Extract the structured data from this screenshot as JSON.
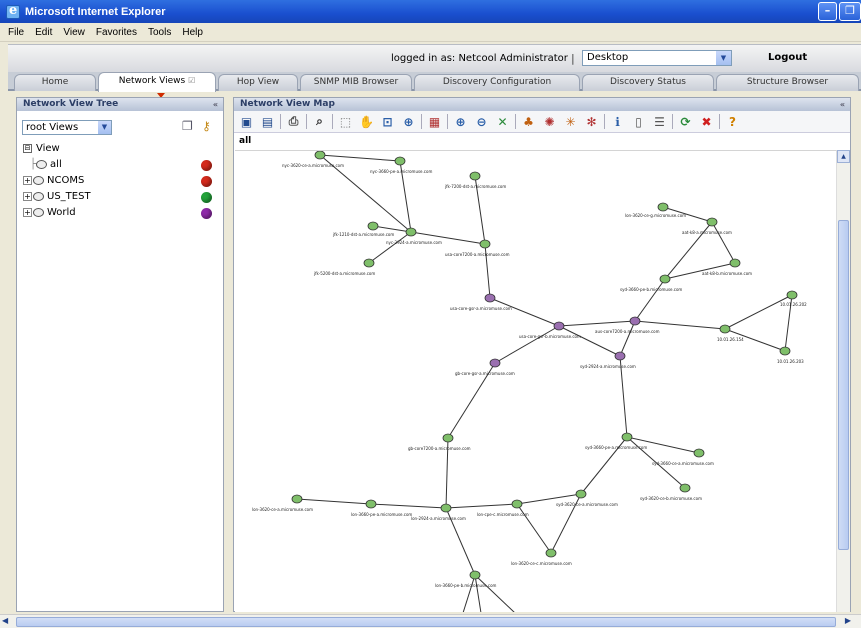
{
  "window": {
    "title": "Microsoft Internet Explorer"
  },
  "menu": [
    "File",
    "Edit",
    "View",
    "Favorites",
    "Tools",
    "Help"
  ],
  "header": {
    "logged_in": "logged in as: Netcool Administrator",
    "separator": "|",
    "desktop_value": "Desktop",
    "logout": "Logout"
  },
  "tabs": [
    {
      "label": "Home"
    },
    {
      "label": "Network Views",
      "active": true
    },
    {
      "label": "Hop View"
    },
    {
      "label": "SNMP MIB Browser"
    },
    {
      "label": "Discovery Configuration"
    },
    {
      "label": "Discovery Status"
    },
    {
      "label": "Structure Browser"
    }
  ],
  "left_panel": {
    "title": "Network View Tree",
    "root_select": "root Views",
    "tree": [
      {
        "label": "View",
        "status": ""
      },
      {
        "label": "all",
        "status": "#d42a1c"
      },
      {
        "label": "NCOMS",
        "status": "#d42a1c"
      },
      {
        "label": "US_TEST",
        "status": "#23a23a"
      },
      {
        "label": "World",
        "status": "#8e2aa8"
      }
    ]
  },
  "right_panel": {
    "title": "Network View Map",
    "view_label": "all"
  },
  "map": {
    "nodes": [
      {
        "label": "nyc-3620-ce-a.micromuse.com"
      },
      {
        "label": "nyc-3660-pe-a.micromuse.com"
      },
      {
        "label": "jfk-7200-dst-a.micromuse.com"
      },
      {
        "label": "jfk-1210-dst-a.micromuse.com"
      },
      {
        "label": "nyc-2924-a.micromuse.com"
      },
      {
        "label": "jfk-5200-dst-a.micromuse.com"
      },
      {
        "label": "usa-core7200-a.micromuse.com"
      },
      {
        "label": "usa-core-gsr-a.micromuse.com"
      },
      {
        "label": "usa-core-gsr-b.micromuse.com"
      },
      {
        "label": "aus-core7200-a.micromuse.com"
      },
      {
        "label": "syd-2924-a.micromuse.com"
      },
      {
        "label": "gb-core-gsr-a.micromuse.com"
      },
      {
        "label": "gb-core7200-a.micromuse.com"
      },
      {
        "label": "lon-3620-ce-g.micromuse.com"
      },
      {
        "label": "aat-k8-a.micromuse.com"
      },
      {
        "label": "aat-k8-b.micromuse.com"
      },
      {
        "label": "syd-3660-pe-b.micromuse.com"
      },
      {
        "label": "10.01.26.202"
      },
      {
        "label": "10.01.26.154"
      },
      {
        "label": "10.01.26.203"
      },
      {
        "label": "syd-3660-pe-a.micromuse.com"
      },
      {
        "label": "syd-3660-ce-a.micromuse.com"
      },
      {
        "label": "syd-3620-ce-b.micromuse.com"
      },
      {
        "label": "lon-3620-ce-a.micromuse.com"
      },
      {
        "label": "lon-3660-pe-a.micromuse.com"
      },
      {
        "label": "lon-2924-a.micromuse.com"
      },
      {
        "label": "lon-cpe-c.micromuse.com"
      },
      {
        "label": "syd-3620-ce-a.micromuse.com"
      },
      {
        "label": "lon-3620-ce-c.micromuse.com"
      },
      {
        "label": "lon-3660-pe-b.micromuse.com"
      }
    ]
  },
  "colors": {
    "titlebar": "#1a4fcf",
    "status_red": "#d42a1c",
    "status_green": "#23a23a",
    "status_purple": "#8e2aa8",
    "node_green": "#7fbf6a",
    "node_purple": "#9a6fb0"
  }
}
